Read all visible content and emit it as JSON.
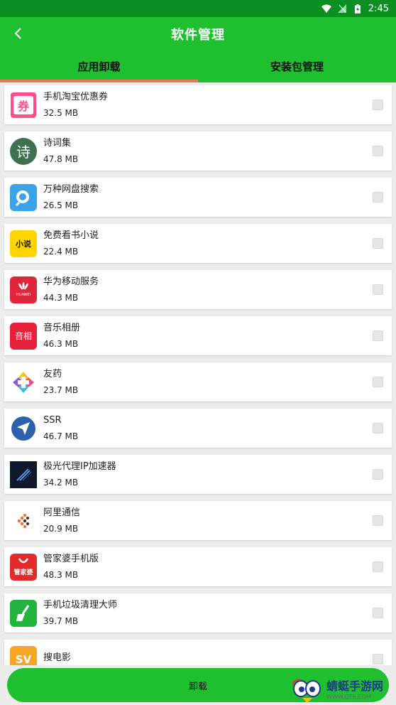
{
  "status_bar": {
    "time": "2:45"
  },
  "header": {
    "title": "软件管理"
  },
  "tabs": [
    {
      "label": "应用卸载",
      "active": true
    },
    {
      "label": "安装包管理",
      "active": false
    }
  ],
  "apps": [
    {
      "name": "手机淘宝优惠券",
      "size": "32.5 MB",
      "icon": "coupon-icon",
      "icon_text": "券"
    },
    {
      "name": "诗词集",
      "size": "47.8 MB",
      "icon": "poetry-icon",
      "icon_text": "诗"
    },
    {
      "name": "万种网盘搜索",
      "size": "26.5 MB",
      "icon": "search-app-icon"
    },
    {
      "name": "免费看书小说",
      "size": "22.4 MB",
      "icon": "novel-icon",
      "icon_text": "小说"
    },
    {
      "name": "华为移动服务",
      "size": "44.3 MB",
      "icon": "huawei-icon",
      "icon_text": "HUAWEI"
    },
    {
      "name": "音乐相册",
      "size": "46.3 MB",
      "icon": "music-album-icon",
      "icon_text": "音相"
    },
    {
      "name": "友药",
      "size": "23.7 MB",
      "icon": "youyao-icon"
    },
    {
      "name": "SSR",
      "size": "46.7 MB",
      "icon": "ssr-icon"
    },
    {
      "name": "极光代理IP加速器",
      "size": "34.2 MB",
      "icon": "jiguang-icon"
    },
    {
      "name": "阿里通信",
      "size": "20.9 MB",
      "icon": "ali-icon"
    },
    {
      "name": "管家婆手机版",
      "size": "48.3 MB",
      "icon": "guanjiapo-icon",
      "icon_text": "管家婆"
    },
    {
      "name": "手机垃圾清理大师",
      "size": "39.7 MB",
      "icon": "cleaner-icon"
    },
    {
      "name": "搜电影",
      "size": "",
      "icon": "sv-icon",
      "icon_text": "SV"
    }
  ],
  "bottom": {
    "uninstall_label": "卸载"
  },
  "watermark": {
    "main": "蜻蜓手游网",
    "sub": "WWW.QT6.COM"
  },
  "colors": {
    "primary": "#1ec030",
    "status": "#0c8f22",
    "tab_indicator": "#e07a5a"
  }
}
